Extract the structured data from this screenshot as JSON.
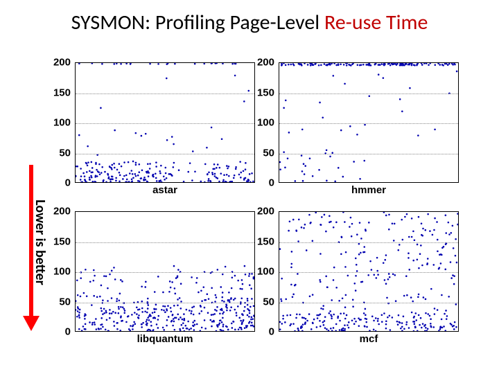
{
  "title_plain": "SYSMON: Profiling Page-Level ",
  "title_red": "Re-use Time",
  "vlabel": "Lower is better",
  "yticks": [
    0,
    50,
    100,
    150,
    200
  ],
  "ymax": 200,
  "panel_count": 300,
  "seeds": {
    "astar": 101,
    "hmmer": 202,
    "libquantum": 303,
    "mcf": 404
  },
  "chart_data": [
    {
      "name": "astar",
      "type": "scatter",
      "xlabel": "astar",
      "ylabel": "",
      "ylim": [
        0,
        200
      ],
      "distribution": "cluster-low-with-top-row",
      "note": "Dense scatter near y<35 across most x, sparse mid-range noise, a band of points at y≈200 along the top edge, a gap around x≈0.55–0.70 with few points.",
      "approx_percentiles": {
        "p50": 15,
        "p90": 35,
        "p100": 200
      }
    },
    {
      "name": "hmmer",
      "type": "scatter",
      "xlabel": "hmmer",
      "ylabel": "",
      "ylim": [
        0,
        200
      ],
      "distribution": "mostly-top-with-sparse-low",
      "note": "Most points near y≈200 along top; sparse points across 0–60 in the left half; very few mid-range points.",
      "approx_percentiles": {
        "p50": 200,
        "p90": 200,
        "p100": 200
      }
    },
    {
      "name": "libquantum",
      "type": "scatter",
      "xlabel": "libquantum",
      "ylabel": "",
      "ylim": [
        0,
        200
      ],
      "distribution": "dense-low-to-mid",
      "note": "Very dense scatter 0–60 across all x, thinning 60–100, almost none above 100.",
      "approx_percentiles": {
        "p50": 25,
        "p90": 65,
        "p100": 100
      }
    },
    {
      "name": "mcf",
      "type": "scatter",
      "xlabel": "mcf",
      "ylabel": "",
      "ylim": [
        0,
        200
      ],
      "distribution": "dense-low-plus-uniform-spread",
      "note": "Dense cluster 0–30 across all x plus fairly uniform scatter 30–200 across all x.",
      "approx_percentiles": {
        "p50": 30,
        "p90": 170,
        "p100": 200
      }
    }
  ]
}
